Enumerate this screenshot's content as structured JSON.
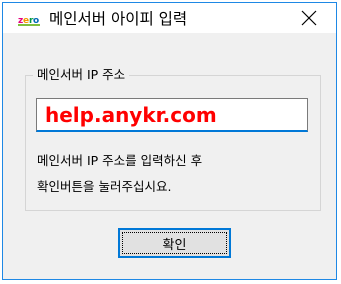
{
  "window": {
    "title": "메인서버 아이피 입력",
    "app_icon": "zeroboard-logo-icon",
    "close_icon": "close-icon"
  },
  "group": {
    "title": "메인서버 IP 주소",
    "input_value": "help.anykr.com",
    "hint_line1": "메인서버 IP 주소를 입력하신 후",
    "hint_line2": "확인버튼을 눌러주십시요."
  },
  "buttons": {
    "ok_label": "확인"
  },
  "colors": {
    "accent": "#0078d7",
    "input_text": "#ff0000",
    "window_bg": "#f0f0f0"
  }
}
